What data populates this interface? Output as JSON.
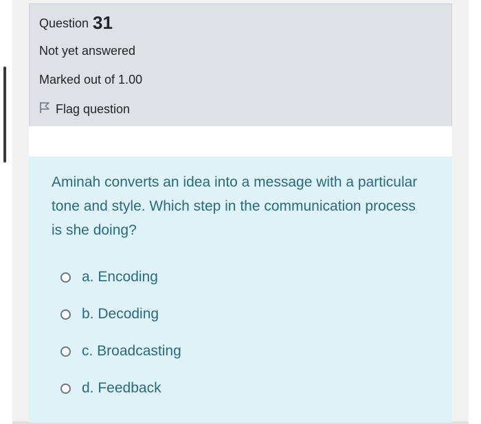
{
  "question": {
    "label": "Question",
    "number": "31",
    "status": "Not yet answered",
    "marks": "Marked out of 1.00",
    "flag_label": "Flag question",
    "text": "Aminah converts an idea into a message with a particular tone and style. Which step in the communication process is she doing?",
    "options": [
      {
        "label": "a. Encoding"
      },
      {
        "label": "b. Decoding"
      },
      {
        "label": "c. Broadcasting"
      },
      {
        "label": "d. Feedback"
      }
    ]
  },
  "icons": {
    "flag": "flag-outline-icon",
    "radio": "radio-unchecked-icon"
  },
  "colors": {
    "info_panel_bg": "#dee2e6",
    "question_panel_bg": "#def2f8",
    "question_text": "#2a6a7a"
  }
}
